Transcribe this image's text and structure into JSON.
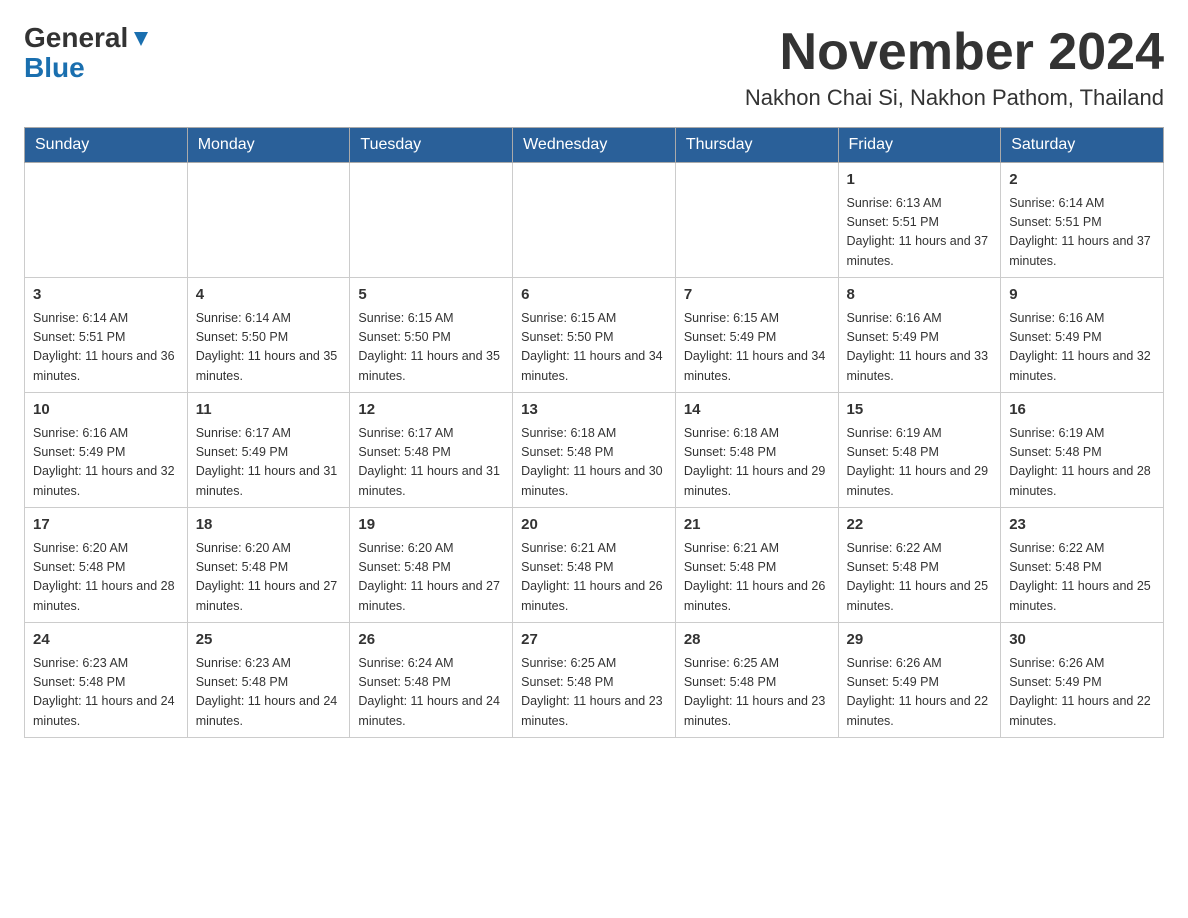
{
  "header": {
    "logo_general": "General",
    "logo_blue": "Blue",
    "month_title": "November 2024",
    "location": "Nakhon Chai Si, Nakhon Pathom, Thailand"
  },
  "weekdays": [
    "Sunday",
    "Monday",
    "Tuesday",
    "Wednesday",
    "Thursday",
    "Friday",
    "Saturday"
  ],
  "weeks": [
    [
      {
        "day": "",
        "info": ""
      },
      {
        "day": "",
        "info": ""
      },
      {
        "day": "",
        "info": ""
      },
      {
        "day": "",
        "info": ""
      },
      {
        "day": "",
        "info": ""
      },
      {
        "day": "1",
        "info": "Sunrise: 6:13 AM\nSunset: 5:51 PM\nDaylight: 11 hours and 37 minutes."
      },
      {
        "day": "2",
        "info": "Sunrise: 6:14 AM\nSunset: 5:51 PM\nDaylight: 11 hours and 37 minutes."
      }
    ],
    [
      {
        "day": "3",
        "info": "Sunrise: 6:14 AM\nSunset: 5:51 PM\nDaylight: 11 hours and 36 minutes."
      },
      {
        "day": "4",
        "info": "Sunrise: 6:14 AM\nSunset: 5:50 PM\nDaylight: 11 hours and 35 minutes."
      },
      {
        "day": "5",
        "info": "Sunrise: 6:15 AM\nSunset: 5:50 PM\nDaylight: 11 hours and 35 minutes."
      },
      {
        "day": "6",
        "info": "Sunrise: 6:15 AM\nSunset: 5:50 PM\nDaylight: 11 hours and 34 minutes."
      },
      {
        "day": "7",
        "info": "Sunrise: 6:15 AM\nSunset: 5:49 PM\nDaylight: 11 hours and 34 minutes."
      },
      {
        "day": "8",
        "info": "Sunrise: 6:16 AM\nSunset: 5:49 PM\nDaylight: 11 hours and 33 minutes."
      },
      {
        "day": "9",
        "info": "Sunrise: 6:16 AM\nSunset: 5:49 PM\nDaylight: 11 hours and 32 minutes."
      }
    ],
    [
      {
        "day": "10",
        "info": "Sunrise: 6:16 AM\nSunset: 5:49 PM\nDaylight: 11 hours and 32 minutes."
      },
      {
        "day": "11",
        "info": "Sunrise: 6:17 AM\nSunset: 5:49 PM\nDaylight: 11 hours and 31 minutes."
      },
      {
        "day": "12",
        "info": "Sunrise: 6:17 AM\nSunset: 5:48 PM\nDaylight: 11 hours and 31 minutes."
      },
      {
        "day": "13",
        "info": "Sunrise: 6:18 AM\nSunset: 5:48 PM\nDaylight: 11 hours and 30 minutes."
      },
      {
        "day": "14",
        "info": "Sunrise: 6:18 AM\nSunset: 5:48 PM\nDaylight: 11 hours and 29 minutes."
      },
      {
        "day": "15",
        "info": "Sunrise: 6:19 AM\nSunset: 5:48 PM\nDaylight: 11 hours and 29 minutes."
      },
      {
        "day": "16",
        "info": "Sunrise: 6:19 AM\nSunset: 5:48 PM\nDaylight: 11 hours and 28 minutes."
      }
    ],
    [
      {
        "day": "17",
        "info": "Sunrise: 6:20 AM\nSunset: 5:48 PM\nDaylight: 11 hours and 28 minutes."
      },
      {
        "day": "18",
        "info": "Sunrise: 6:20 AM\nSunset: 5:48 PM\nDaylight: 11 hours and 27 minutes."
      },
      {
        "day": "19",
        "info": "Sunrise: 6:20 AM\nSunset: 5:48 PM\nDaylight: 11 hours and 27 minutes."
      },
      {
        "day": "20",
        "info": "Sunrise: 6:21 AM\nSunset: 5:48 PM\nDaylight: 11 hours and 26 minutes."
      },
      {
        "day": "21",
        "info": "Sunrise: 6:21 AM\nSunset: 5:48 PM\nDaylight: 11 hours and 26 minutes."
      },
      {
        "day": "22",
        "info": "Sunrise: 6:22 AM\nSunset: 5:48 PM\nDaylight: 11 hours and 25 minutes."
      },
      {
        "day": "23",
        "info": "Sunrise: 6:22 AM\nSunset: 5:48 PM\nDaylight: 11 hours and 25 minutes."
      }
    ],
    [
      {
        "day": "24",
        "info": "Sunrise: 6:23 AM\nSunset: 5:48 PM\nDaylight: 11 hours and 24 minutes."
      },
      {
        "day": "25",
        "info": "Sunrise: 6:23 AM\nSunset: 5:48 PM\nDaylight: 11 hours and 24 minutes."
      },
      {
        "day": "26",
        "info": "Sunrise: 6:24 AM\nSunset: 5:48 PM\nDaylight: 11 hours and 24 minutes."
      },
      {
        "day": "27",
        "info": "Sunrise: 6:25 AM\nSunset: 5:48 PM\nDaylight: 11 hours and 23 minutes."
      },
      {
        "day": "28",
        "info": "Sunrise: 6:25 AM\nSunset: 5:48 PM\nDaylight: 11 hours and 23 minutes."
      },
      {
        "day": "29",
        "info": "Sunrise: 6:26 AM\nSunset: 5:49 PM\nDaylight: 11 hours and 22 minutes."
      },
      {
        "day": "30",
        "info": "Sunrise: 6:26 AM\nSunset: 5:49 PM\nDaylight: 11 hours and 22 minutes."
      }
    ]
  ]
}
